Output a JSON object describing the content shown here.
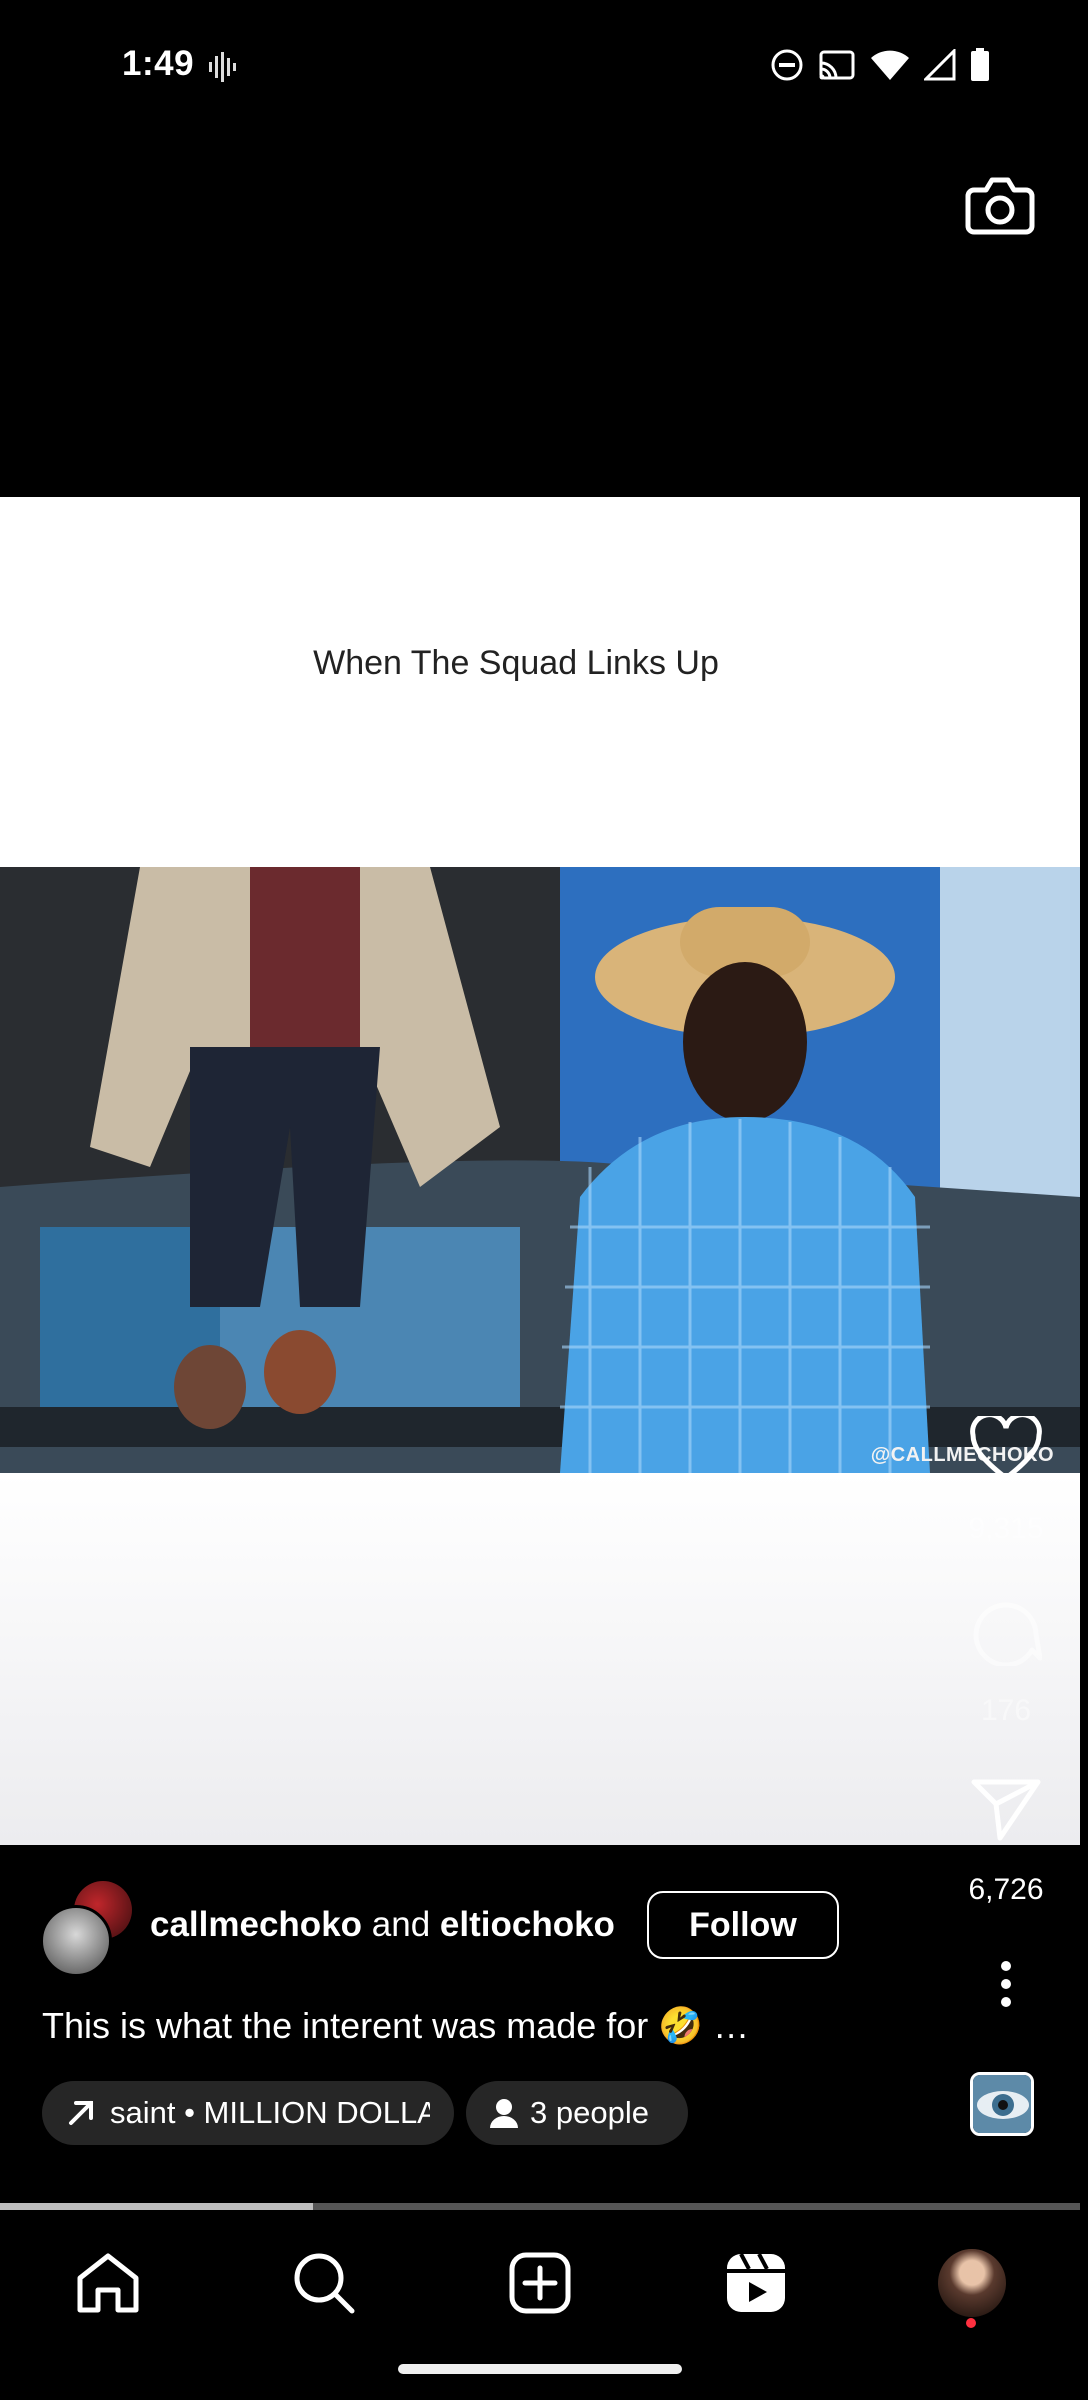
{
  "status_bar": {
    "time": "1:49",
    "icons": [
      "voice-waveform-icon",
      "do-not-disturb-icon",
      "cast-icon",
      "wifi-icon",
      "cellular-signal-icon",
      "battery-icon"
    ]
  },
  "top_bar": {
    "camera_icon": "camera-icon"
  },
  "video": {
    "caption": "When The Squad Links Up",
    "watermark": "@CALLMECHOKO"
  },
  "actions": {
    "like_count": "9,315",
    "comment_count": "176",
    "share_count": "6,726"
  },
  "post": {
    "author_primary": "callmechoko",
    "connector": "and",
    "author_secondary": "eltiochoko",
    "follow_label": "Follow",
    "description": "This is what the interent was made for 🤣 …",
    "audio_label": "saint • MILLION DOLLA",
    "people_label": "3 people",
    "progress": 0.29
  },
  "nav": {
    "items": [
      "home-icon",
      "search-icon",
      "create-icon",
      "reels-icon",
      "profile-avatar"
    ]
  },
  "colors": {
    "background": "#000000",
    "chip_background": "#262626",
    "notification_dot": "#ff3040"
  }
}
